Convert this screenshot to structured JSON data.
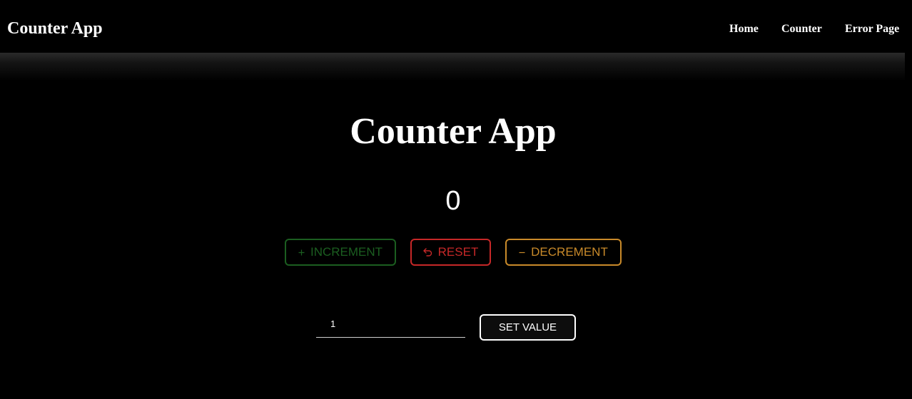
{
  "navbar": {
    "brand": "Counter App",
    "links": [
      {
        "label": "Home"
      },
      {
        "label": "Counter"
      },
      {
        "label": "Error Page"
      }
    ]
  },
  "main": {
    "title": "Counter App",
    "count": "0",
    "buttons": {
      "increment": {
        "label": "INCREMENT",
        "icon": "plus-icon",
        "color": "#1b5e20"
      },
      "reset": {
        "label": "RESET",
        "icon": "undo-icon",
        "color": "#c62828"
      },
      "decrement": {
        "label": "DECREMENT",
        "icon": "minus-icon",
        "color": "#c98a2a"
      }
    },
    "set_value": {
      "input_value": "1",
      "button_label": "SET VALUE"
    }
  },
  "colors": {
    "background": "#000000",
    "text": "#ffffff"
  }
}
